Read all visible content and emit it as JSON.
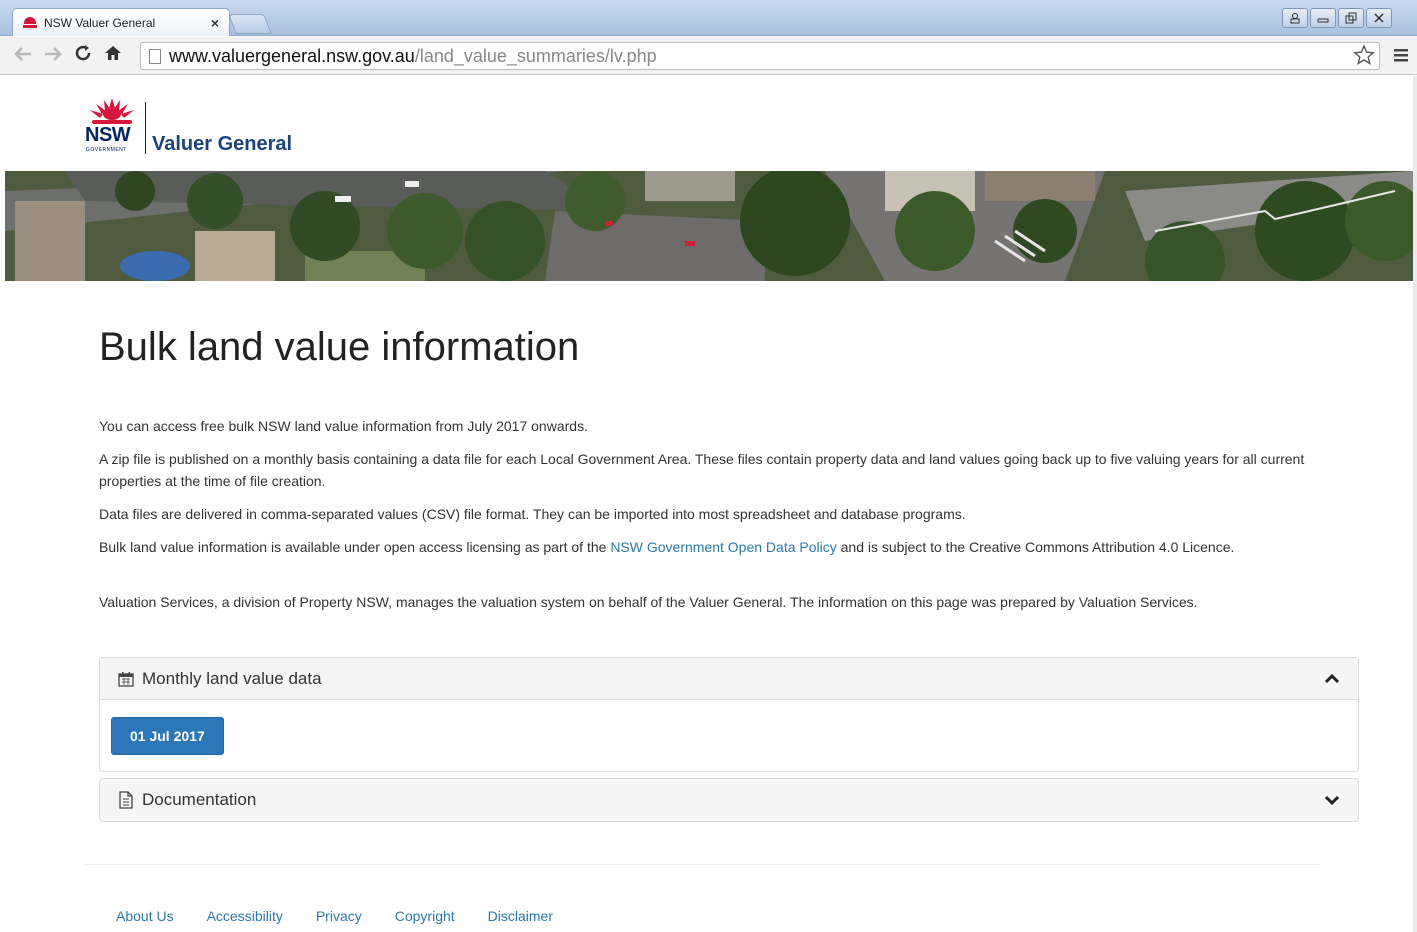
{
  "browser": {
    "tab_title": "NSW Valuer General",
    "tab_close": "×",
    "url_host": "www.valuergeneral.nsw.gov.au",
    "url_path": "/land_value_summaries/lv.php"
  },
  "header": {
    "logo_nsw": "NSW",
    "logo_gov": "GOVERNMENT",
    "logo_name": "Valuer General"
  },
  "main": {
    "title": "Bulk land value information",
    "paragraphs": {
      "p1": "You can access free bulk NSW land value information from July 2017 onwards.",
      "p2": "A zip file is published on a monthly basis containing a data file for each Local Government Area. These files contain property data and land values going back up to five valuing years for all current properties at the time of file creation.",
      "p3": "Data files are delivered in comma-separated values (CSV) file format. They can be imported into most spreadsheet and database programs.",
      "p4_before": "Bulk land value information is available under open access licensing as part of the ",
      "p4_link": "NSW Government Open Data Policy",
      "p4_after": " and is subject to the Creative Commons Attribution 4.0 Licence.",
      "p5": "Valuation Services, a division of Property NSW, manages the valuation system on behalf of the Valuer General. The information on this page was prepared by Valuation Services."
    },
    "panels": {
      "monthly_title": "Monthly land value data",
      "monthly_button": "01 Jul 2017",
      "documentation_title": "Documentation"
    }
  },
  "footer": {
    "links": [
      "About Us",
      "Accessibility",
      "Privacy",
      "Copyright",
      "Disclaimer"
    ]
  },
  "colors": {
    "link": "#2a7ab0",
    "button": "#2c77b8",
    "nsw_navy": "#002664",
    "nsw_red": "#d7153a"
  }
}
